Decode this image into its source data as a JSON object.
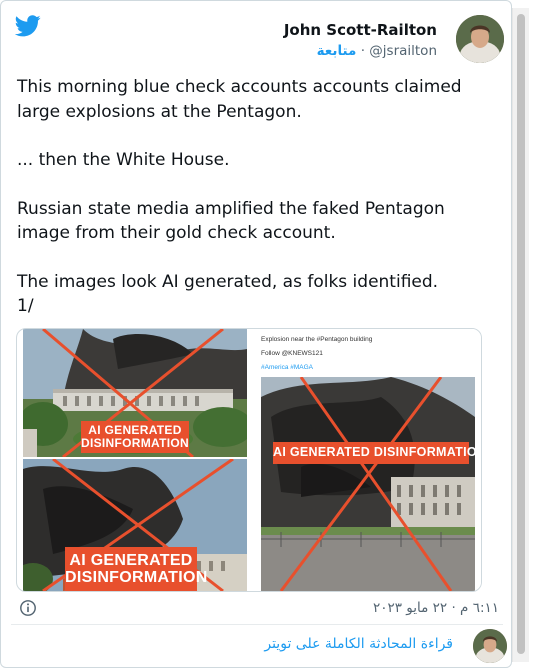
{
  "author": {
    "name": "John Scott-Railton",
    "handle": "@jsrailton",
    "separator": "·",
    "follow_label": "متابعة"
  },
  "tweet": {
    "paragraphs": [
      "This morning blue check accounts accounts claimed large explosions at the Pentagon.",
      "... then the White House.",
      "Russian state media amplified the faked Pentagon image from their gold check account.",
      "The images look AI generated, as folks identified.\n1/"
    ]
  },
  "media": {
    "left_top_label": "AI GENERATED\nDISINFORMATION",
    "left_bottom_label": "AI GENERATED\nDISINFORMATION",
    "right_label": "AI GENERATED DISINFORMATION",
    "right_caption_line1": "Explosion near the #Pentagon building",
    "right_caption_line2": "Follow @KNEWS121",
    "right_caption_line3": "#America #MAGA"
  },
  "timestamp": "٦:١١ م · ٢٢ مايو ٢٠٢٣",
  "footer": {
    "read_conversation": "قراءة المحادثة الكاملة على تويتر"
  },
  "colors": {
    "twitter_blue": "#1d9bf0",
    "label_red": "#e8502d",
    "text_primary": "#0f1419",
    "text_secondary": "#536471"
  },
  "icons": {
    "logo": "twitter-bird-icon",
    "info": "info-icon"
  }
}
